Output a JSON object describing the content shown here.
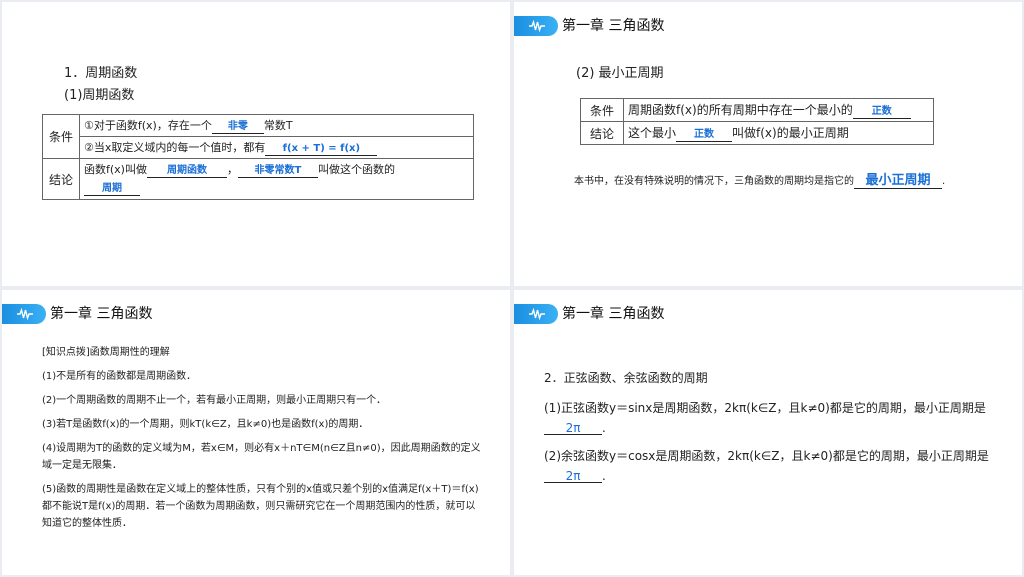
{
  "chapter_title": "第一章 三角函数",
  "panel1": {
    "heading1": "1．周期函数",
    "heading2": "(1)周期函数",
    "cond_label": "条件",
    "cond1_a": "①对于函数f(x)，存在一个",
    "cond1_blank": "非零",
    "cond1_b": "常数T",
    "cond2_a": "②当x取定义域内的每一个值时，都有",
    "cond2_blank": "f(x + T) = f(x)",
    "concl_label": "结论",
    "concl_a": "函数f(x)叫做",
    "concl_blank1": "周期函数",
    "concl_sep": "，",
    "concl_blank2": "非零常数T",
    "concl_b": "叫做这个函数的",
    "concl_blank3": "周期"
  },
  "panel2": {
    "heading": "(2) 最小正周期",
    "row1_label": "条件",
    "row1_text": "周期函数f(x)的所有周期中存在一个最小的",
    "row1_blank": "正数",
    "row2_label": "结论",
    "row2_a": "这个最小",
    "row2_blank": "正数",
    "row2_b": "叫做f(x)的最小正周期",
    "note_a": "本书中，在没有特殊说明的情况下，三角函数的周期均是指它的",
    "note_blank": "最小正周期",
    "note_end": "."
  },
  "panel3": {
    "items": [
      "[知识点拨]函数周期性的理解",
      "(1)不是所有的函数都是周期函数．",
      "(2)一个周期函数的周期不止一个，若有最小正周期，则最小正周期只有一个．",
      "(3)若T是函数f(x)的一个周期，则kT(k∈Z，且k≠0)也是函数f(x)的周期．",
      "(4)设周期为T的函数的定义域为M，若x∈M，则必有x＋nT∈M(n∈Z且n≠0)，因此周期函数的定义域一定是无限集．",
      "(5)函数的周期性是函数在定义域上的整体性质，只有个别的x值或只差个别的x值满足f(x＋T)＝f(x)都不能说T是f(x)的周期．若一个函数为周期函数，则只需研究它在一个周期范围内的性质，就可以知道它的整体性质．"
    ]
  },
  "panel4": {
    "heading": "2．正弦函数、余弦函数的周期",
    "sin_a": "(1)正弦函数y＝sinx是周期函数，2kπ(k∈Z，且k≠0)都是它的周期，最小正周期是",
    "sin_blank": "2π",
    "sin_end": ".",
    "cos_a": "(2)余弦函数y＝cosx是周期函数，2kπ(k∈Z，且k≠0)都是它的周期，最小正周期是",
    "cos_blank": "2π",
    "cos_end": "."
  },
  "colors": {
    "accent": "#1a8fe0",
    "answer": "#1a6fd6"
  },
  "icons": {
    "chapter_tab": "wave-icon"
  }
}
